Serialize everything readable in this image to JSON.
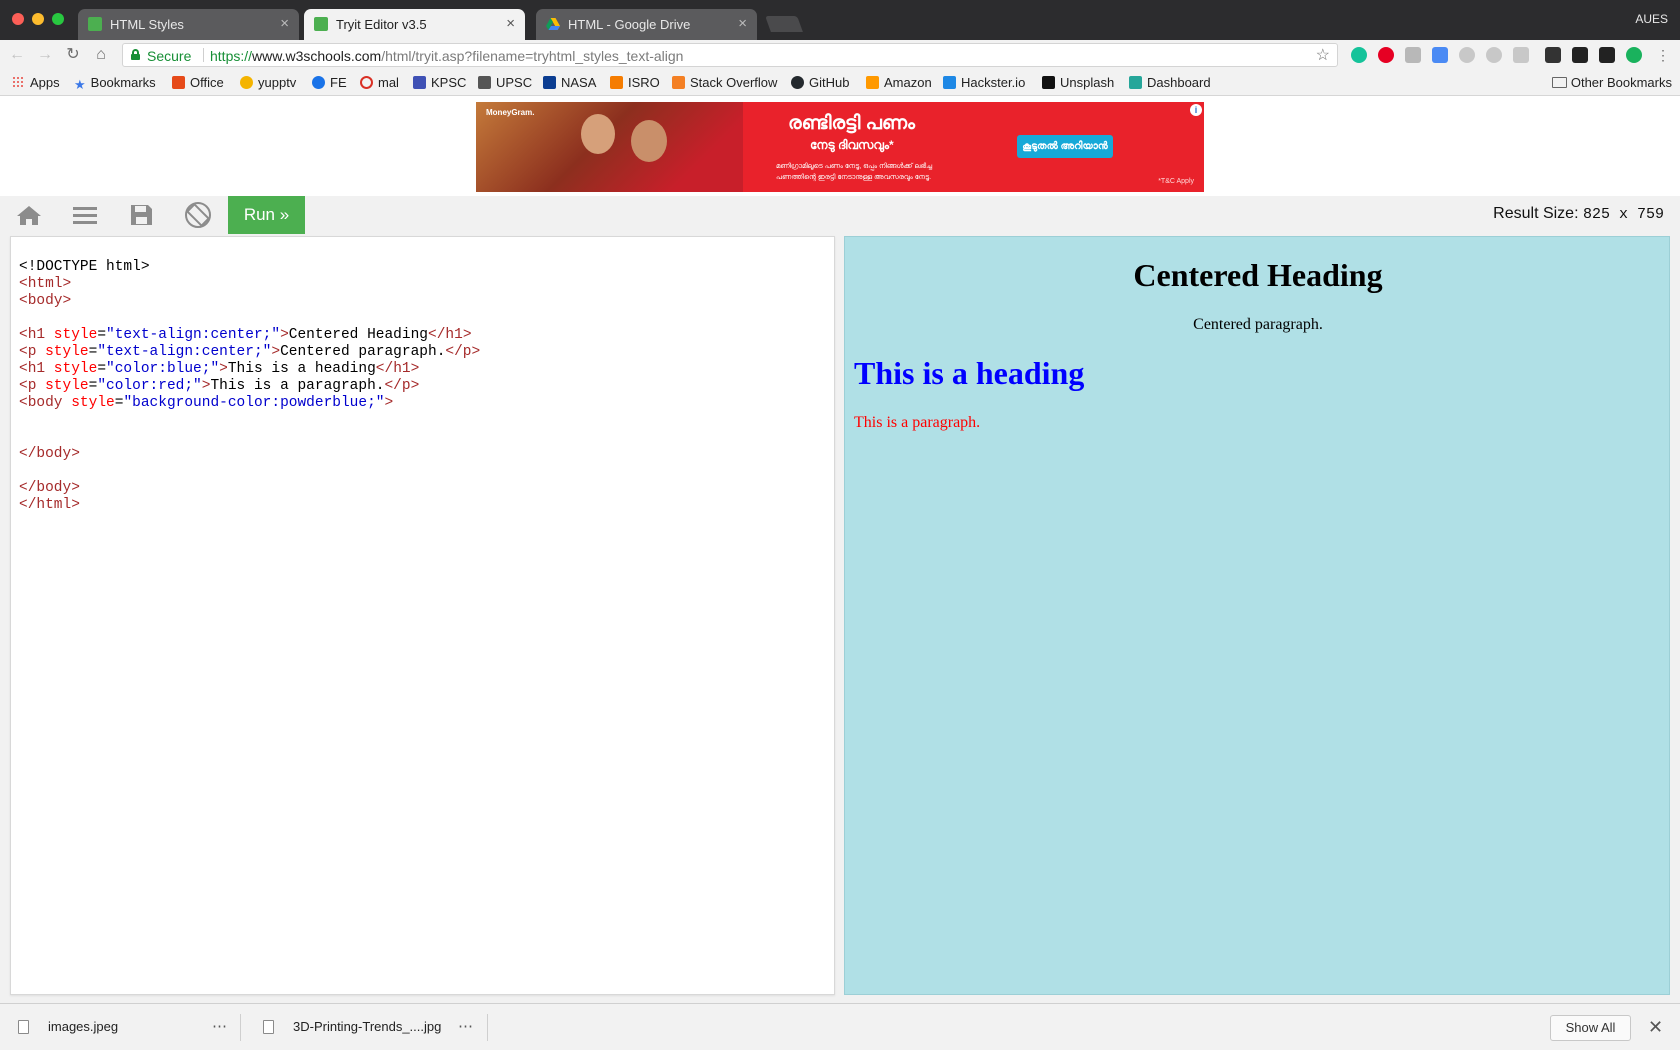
{
  "browser": {
    "tabs": [
      {
        "title": "HTML Styles",
        "active": false,
        "icon": "w3schools-icon"
      },
      {
        "title": "Tryit Editor v3.5",
        "active": true,
        "icon": "w3schools-icon"
      },
      {
        "title": "HTML - Google Drive",
        "active": false,
        "icon": "google-drive-icon"
      }
    ],
    "profile": "AUES",
    "address": {
      "secure_label": "Secure",
      "url_scheme": "https://",
      "url_host": "www.w3schools.com",
      "url_path": "/html/tryit.asp?filename=tryhtml_styles_text-align"
    },
    "bookmarks": [
      {
        "label": "Apps",
        "icon": "apps-grid-icon",
        "color": "#e8453c"
      },
      {
        "label": "Bookmarks",
        "icon": "star-icon",
        "color": "#3b78e7"
      },
      {
        "label": "Office",
        "icon": "office-icon",
        "color": "#e64a19"
      },
      {
        "label": "yupptv",
        "icon": "yupptv-icon",
        "color": "#f4b400"
      },
      {
        "label": "FE",
        "icon": "fe-icon",
        "color": "#1a73e8"
      },
      {
        "label": "mal",
        "icon": "mal-icon",
        "color": "#d93025"
      },
      {
        "label": "KPSC",
        "icon": "kpsc-icon",
        "color": "#3f51b5"
      },
      {
        "label": "UPSC",
        "icon": "upsc-icon",
        "color": "#555555"
      },
      {
        "label": "NASA",
        "icon": "nasa-icon",
        "color": "#0b3d91"
      },
      {
        "label": "ISRO",
        "icon": "isro-icon",
        "color": "#f57c00"
      },
      {
        "label": "Stack Overflow",
        "icon": "stackoverflow-icon",
        "color": "#f48024"
      },
      {
        "label": "GitHub",
        "icon": "github-icon",
        "color": "#24292e"
      },
      {
        "label": "Amazon",
        "icon": "amazon-icon",
        "color": "#ff9900"
      },
      {
        "label": "Hackster.io",
        "icon": "hackster-icon",
        "color": "#1e88e5"
      },
      {
        "label": "Unsplash",
        "icon": "camera-icon",
        "color": "#111111"
      },
      {
        "label": "Dashboard",
        "icon": "dashboard-icon",
        "color": "#26a69a"
      }
    ],
    "other_bookmarks": "Other Bookmarks"
  },
  "ad": {
    "brand": "MoneyGram.",
    "headline": "രണ്ടിരട്ടി പണം",
    "subheadline": "നേടു ദിവസവും*",
    "line1": "മണിഗ്രാമിലൂടെ പണം നേടൂ, ഒപ്പം നിങ്ങൾക്ക് ലഭിച്ച",
    "line2": "പണത്തിന്റെ ഇരട്ടി നേടാനുള്ള അവസരവും നേടൂ.",
    "cta": "കൂടുതൽ അറിയാൻ",
    "terms": "*T&C Apply"
  },
  "toolbar": {
    "run_label": "Run »",
    "result_size_label": "Result Size:",
    "result_size_value": "825 x 759"
  },
  "editor": {
    "lines": [
      "<!DOCTYPE html>",
      "<html>",
      "<body>",
      "",
      "<h1 style=\"text-align:center;\">Centered Heading</h1>",
      "<p style=\"text-align:center;\">Centered paragraph.</p>",
      "<h1 style=\"color:blue;\">This is a heading</h1>",
      "<p style=\"color:red;\">This is a paragraph.</p>",
      "<body style=\"background-color:powderblue;\">",
      "",
      "",
      "</body>",
      "",
      "</body>",
      "</html>"
    ]
  },
  "result": {
    "background": "#b0e0e6",
    "heading_centered": "Centered Heading",
    "paragraph_centered": "Centered paragraph.",
    "heading_blue": "This is a heading",
    "paragraph_red": "This is a paragraph."
  },
  "downloads": {
    "items": [
      {
        "filename": "images.jpeg"
      },
      {
        "filename": "3D-Printing-Trends_....jpg"
      }
    ],
    "show_all": "Show All"
  }
}
